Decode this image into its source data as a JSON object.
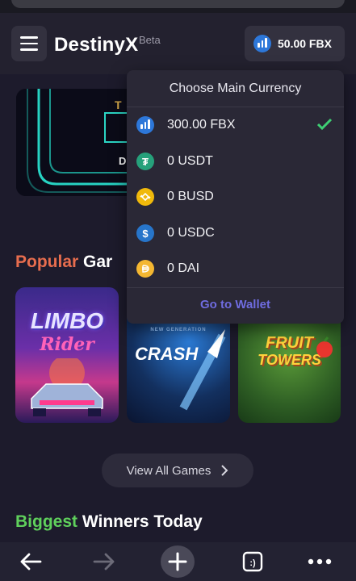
{
  "header": {
    "app_name": "DestinyX",
    "badge": "Beta",
    "balance": "50.00 FBX",
    "balance_icon": "fbx-coin-icon"
  },
  "currency_menu": {
    "title": "Choose Main Currency",
    "items": [
      {
        "label": "300.00 FBX",
        "icon": "fbx-coin-icon",
        "color": "#2d77d9",
        "selected": true
      },
      {
        "label": "0 USDT",
        "icon": "tether-coin-icon",
        "color": "#26a17b",
        "selected": false
      },
      {
        "label": "0 BUSD",
        "icon": "busd-coin-icon",
        "color": "#f0b90b",
        "selected": false
      },
      {
        "label": "0 USDC",
        "icon": "usdc-coin-icon",
        "color": "#2775ca",
        "selected": false
      },
      {
        "label": "0 DAI",
        "icon": "dai-coin-icon",
        "color": "#f4b731",
        "selected": false
      }
    ],
    "footer_link": "Go to Wallet"
  },
  "popular_section": {
    "title_accent": "Popular",
    "title_rest": "Gar",
    "games": [
      {
        "name": "LIMBO",
        "subtitle": "Rider"
      },
      {
        "name": "CRASH",
        "subtitle": "NEW GENERATION"
      },
      {
        "name": "FRUIT",
        "subtitle": "TOWERS"
      }
    ],
    "view_all_label": "View All Games"
  },
  "winners_section": {
    "title_accent": "Biggest",
    "title_rest": "Winners Today"
  },
  "banner_text": {
    "letter1": "T",
    "letter2": "D"
  },
  "colors": {
    "accent_orange": "#e76d4e",
    "accent_green": "#5fd05c",
    "link_purple": "#6f6ce0",
    "check_green": "#3ecf74"
  }
}
